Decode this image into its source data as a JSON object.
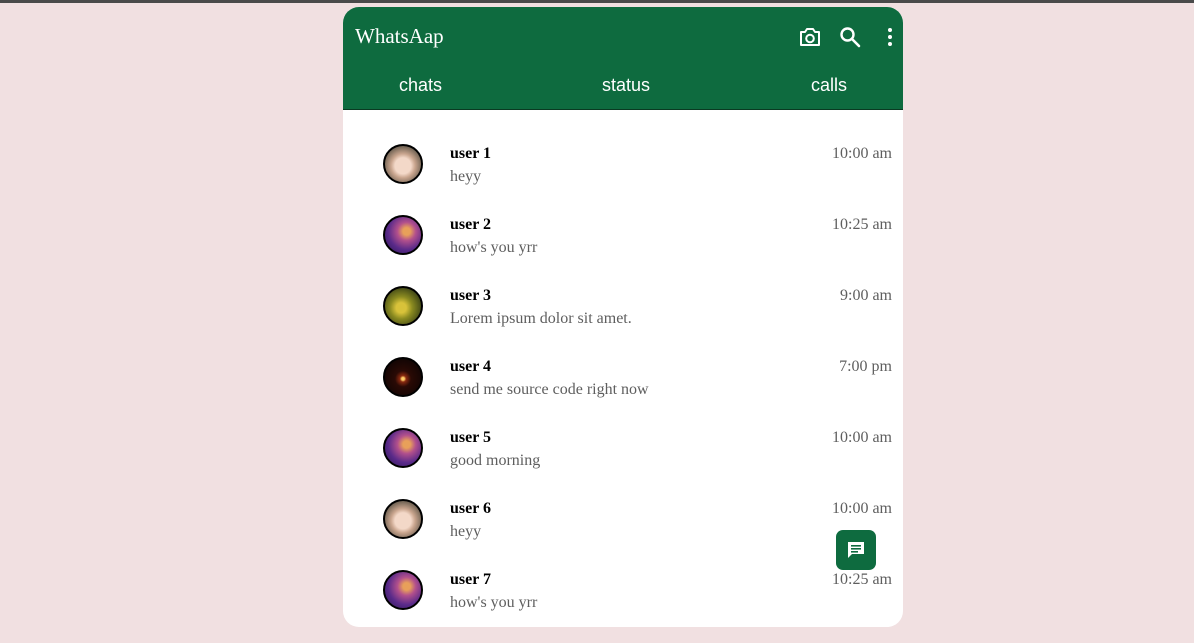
{
  "app": {
    "title": "WhatsAap"
  },
  "header_icons": [
    "camera-icon",
    "search-icon",
    "more-vert-icon"
  ],
  "tabs": [
    {
      "label": "chats"
    },
    {
      "label": "status"
    },
    {
      "label": "calls"
    }
  ],
  "chats": [
    {
      "name": "user 1",
      "message": "heyy",
      "time": "10:00 am",
      "avatar": "baby"
    },
    {
      "name": "user 2",
      "message": "how's you yrr",
      "time": "10:25 am",
      "avatar": "sunset"
    },
    {
      "name": "user 3",
      "message": "Lorem ipsum dolor sit amet.",
      "time": "9:00 am",
      "avatar": "leaves"
    },
    {
      "name": "user 4",
      "message": "send me source code right now",
      "time": "7:00 pm",
      "avatar": "candle"
    },
    {
      "name": "user 5",
      "message": "good morning",
      "time": "10:00 am",
      "avatar": "sunset"
    },
    {
      "name": "user 6",
      "message": "heyy",
      "time": "10:00 am",
      "avatar": "baby"
    },
    {
      "name": "user 7",
      "message": "how's you yrr",
      "time": "10:25 am",
      "avatar": "sunset"
    }
  ],
  "fab": {
    "icon": "new-chat-icon"
  },
  "colors": {
    "header": "#0e6b3f",
    "background": "#f1e0e1",
    "secondary_text": "#5e5e5e"
  }
}
